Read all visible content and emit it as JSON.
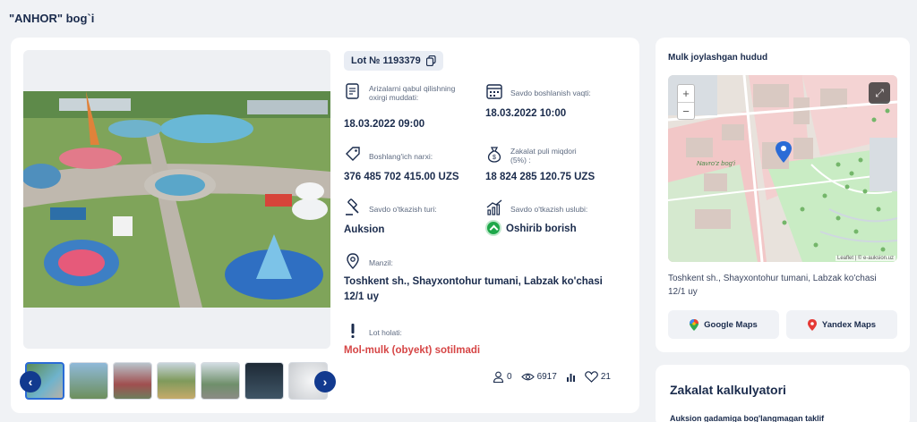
{
  "page": {
    "title": "\"ANHOR\" bog`i"
  },
  "lot": {
    "number": "Lot № 1193379",
    "deadline": {
      "label": "Arizalarni qabul qilishning oxirgi muddati:",
      "value": "18.03.2022 09:00"
    },
    "start": {
      "label": "Savdo boshlanish vaqti:",
      "value": "18.03.2022 10:00"
    },
    "price": {
      "label": "Boshlang'ich narxi:",
      "value": "376 485 702 415.00 UZS"
    },
    "deposit": {
      "label": "Zakalat puli miqdori (5%) :",
      "value": "18 824 285 120.75 UZS"
    },
    "type": {
      "label": "Savdo o'tkazish turi:",
      "value": "Auksion"
    },
    "method": {
      "label": "Savdo o'tkazish uslubi:",
      "value": "Oshirib borish"
    },
    "address": {
      "label": "Manzil:",
      "value": "Toshkent sh., Shayxontohur tumani, Labzak ko'chasi 12/1 uy"
    },
    "status": {
      "label": "Lot holati:",
      "value": "Mol-mulk (obyekt) sotilmadi",
      "color": "#d64545"
    },
    "stats": {
      "participants": "0",
      "views": "6917",
      "likes": "21"
    }
  },
  "gallery": {
    "prev": "‹",
    "next": "›",
    "thumb_count": 7
  },
  "map": {
    "title": "Mulk joylashgan hudud",
    "zoom_in": "+",
    "zoom_out": "−",
    "park_label": "Navro'z bog'i",
    "attribution": "Leaflet | © e-auksion.uz",
    "address": "Toshkent sh., Shayxontohur tumani, Labzak ko'chasi 12/1 uy",
    "google_button": "Google Maps",
    "yandex_button": "Yandex Maps"
  },
  "calculator": {
    "title": "Zakalat kalkulyatori",
    "subtitle": "Auksion gadamiga bog'langmagan taklif"
  },
  "colors": {
    "navy": "#123a8f",
    "accent_red": "#d64545",
    "green": "#1ea84a",
    "map_pin": "#2a6bd6"
  }
}
